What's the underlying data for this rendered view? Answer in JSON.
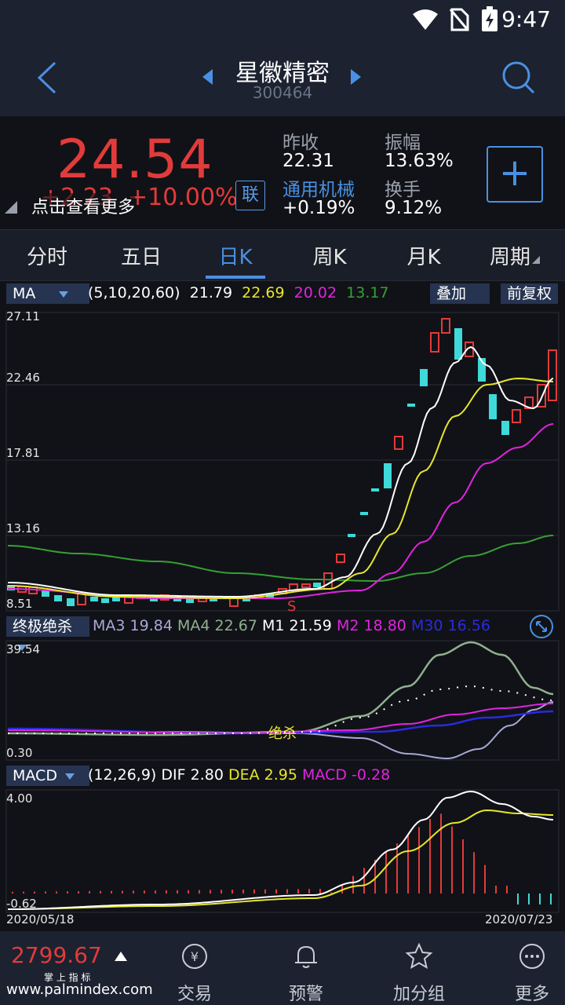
{
  "status": {
    "time": "9:47"
  },
  "header": {
    "title": "星徽精密",
    "code": "300464"
  },
  "quote": {
    "price": "24.54",
    "change": "+2.23",
    "change_pct": "+10.00%",
    "tip": "点击查看更多",
    "lian": "联",
    "prev_close_label": "昨收",
    "prev_close": "22.31",
    "amplitude_label": "振幅",
    "amplitude": "13.63%",
    "sector": "通用机械",
    "sector_change": "+0.19%",
    "turnover_label": "换手",
    "turnover": "9.12%",
    "add": "+"
  },
  "tabs": [
    "分时",
    "五日",
    "日K",
    "周K",
    "月K",
    "周期"
  ],
  "ma_bar": {
    "selector": "MA",
    "params": "(5,10,20,60)",
    "v1": "21.79",
    "v2": "22.69",
    "v3": "20.02",
    "v4": "13.17",
    "overlay": "叠加",
    "adjust": "前复权"
  },
  "kline_axis": [
    "27.11",
    "22.46",
    "17.81",
    "13.16",
    "8.51"
  ],
  "zjjs_bar": {
    "selector": "终极绝杀",
    "ma3_label": "MA3",
    "ma3": "19.84",
    "ma4_label": "MA4",
    "ma4": "22.67",
    "m1_label": "M1",
    "m1": "21.59",
    "m2_label": "M2",
    "m2": "18.80",
    "m30_label": "M30",
    "m30": "16.56"
  },
  "zjjs_axis": [
    "39.54",
    "0.30"
  ],
  "zjjs_mark": "绝杀",
  "s_mark": "S",
  "macd_bar": {
    "selector": "MACD",
    "params": "(12,26,9)",
    "dif_label": "DIF",
    "dif": "2.80",
    "dea_label": "DEA",
    "dea": "2.95",
    "macd_label": "MACD",
    "macd": "-0.28"
  },
  "macd_axis": [
    "4.00",
    "-0.62"
  ],
  "dates": [
    "2020/05/18",
    "2020/07/23"
  ],
  "nav": {
    "index_value": "2799.67",
    "index_sub": "掌 上 指 标",
    "items": [
      "交易",
      "预警",
      "加分组",
      "更多"
    ]
  },
  "watermark": "www.palmindex.com",
  "colors": {
    "up": "#e23b3b",
    "down": "#3fd9d9",
    "ma5": "#ffffff",
    "ma10": "#e6e62e",
    "ma20": "#e024e0",
    "ma60": "#35a035",
    "accent": "#4a90e2"
  }
}
